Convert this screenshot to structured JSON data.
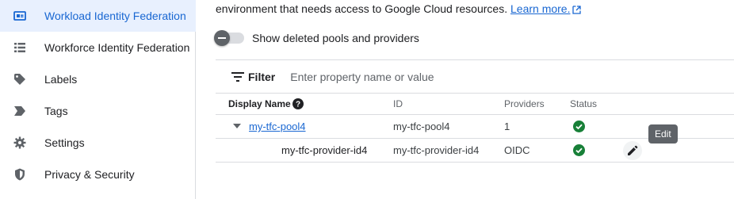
{
  "sidebar": {
    "items": [
      {
        "label": "Workload Identity Federation",
        "icon": "id-card-icon",
        "active": true
      },
      {
        "label": "Workforce Identity Federation",
        "icon": "list-icon",
        "active": false
      },
      {
        "label": "Labels",
        "icon": "label-icon",
        "active": false
      },
      {
        "label": "Tags",
        "icon": "tag-arrow-icon",
        "active": false
      },
      {
        "label": "Settings",
        "icon": "gear-icon",
        "active": false
      },
      {
        "label": "Privacy & Security",
        "icon": "shield-icon",
        "active": false
      }
    ]
  },
  "main": {
    "description_text": "environment that needs access to Google Cloud resources.",
    "learn_more_label": "Learn more.",
    "toggle_label": "Show deleted pools and providers",
    "toggle_on": false,
    "filter_label": "Filter",
    "filter_placeholder": "Enter property name or value"
  },
  "table": {
    "columns": [
      "Display Name",
      "ID",
      "Providers",
      "Status"
    ],
    "rows": [
      {
        "name": "my-tfc-pool4",
        "id": "my-tfc-pool4",
        "providers": "1",
        "status": "ok"
      },
      {
        "name": "my-tfc-provider-id4",
        "id": "my-tfc-provider-id4",
        "providers": "OIDC",
        "status": "ok"
      }
    ]
  },
  "tooltip": "Edit",
  "colors": {
    "accent": "#1967d2",
    "active_bg": "#e8f0fe",
    "status_ok": "#188038"
  }
}
